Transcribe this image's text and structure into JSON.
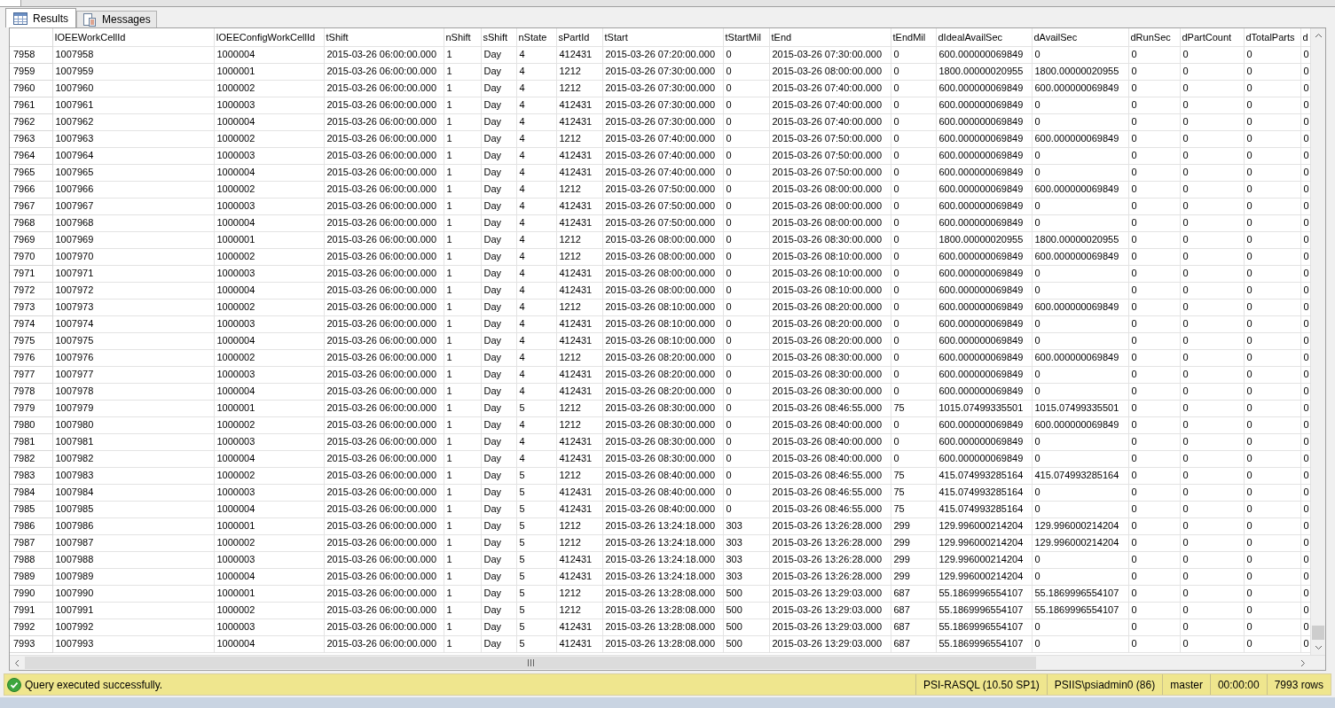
{
  "tabs": [
    {
      "label": "Results",
      "selected": true,
      "kind": "grid"
    },
    {
      "label": "Messages",
      "selected": false,
      "kind": "messages"
    }
  ],
  "grid": {
    "columns": [
      "IOEEWorkCellId",
      "IOEEConfigWorkCellId",
      "tShift",
      "nShift",
      "sShift",
      "nState",
      "sPartId",
      "tStart",
      "tStartMil",
      "tEnd",
      "tEndMil",
      "dIdealAvailSec",
      "dAvailSec",
      "dRunSec",
      "dPartCount",
      "dTotalParts",
      "d"
    ],
    "rows": [
      {
        "number": "7958",
        "cells": [
          "1007958",
          "1000004",
          "2015-03-26 06:00:00.000",
          "1",
          "Day",
          "4",
          "412431",
          "2015-03-26 07:20:00.000",
          "0",
          "2015-03-26 07:30:00.000",
          "0",
          "600.000000069849",
          "0",
          "0",
          "0",
          "0",
          "0"
        ]
      },
      {
        "number": "7959",
        "cells": [
          "1007959",
          "1000001",
          "2015-03-26 06:00:00.000",
          "1",
          "Day",
          "4",
          "1212",
          "2015-03-26 07:30:00.000",
          "0",
          "2015-03-26 08:00:00.000",
          "0",
          "1800.00000020955",
          "1800.00000020955",
          "0",
          "0",
          "0",
          "0"
        ]
      },
      {
        "number": "7960",
        "cells": [
          "1007960",
          "1000002",
          "2015-03-26 06:00:00.000",
          "1",
          "Day",
          "4",
          "1212",
          "2015-03-26 07:30:00.000",
          "0",
          "2015-03-26 07:40:00.000",
          "0",
          "600.000000069849",
          "600.000000069849",
          "0",
          "0",
          "0",
          "0"
        ]
      },
      {
        "number": "7961",
        "cells": [
          "1007961",
          "1000003",
          "2015-03-26 06:00:00.000",
          "1",
          "Day",
          "4",
          "412431",
          "2015-03-26 07:30:00.000",
          "0",
          "2015-03-26 07:40:00.000",
          "0",
          "600.000000069849",
          "0",
          "0",
          "0",
          "0",
          "0"
        ]
      },
      {
        "number": "7962",
        "cells": [
          "1007962",
          "1000004",
          "2015-03-26 06:00:00.000",
          "1",
          "Day",
          "4",
          "412431",
          "2015-03-26 07:30:00.000",
          "0",
          "2015-03-26 07:40:00.000",
          "0",
          "600.000000069849",
          "0",
          "0",
          "0",
          "0",
          "0"
        ]
      },
      {
        "number": "7963",
        "cells": [
          "1007963",
          "1000002",
          "2015-03-26 06:00:00.000",
          "1",
          "Day",
          "4",
          "1212",
          "2015-03-26 07:40:00.000",
          "0",
          "2015-03-26 07:50:00.000",
          "0",
          "600.000000069849",
          "600.000000069849",
          "0",
          "0",
          "0",
          "0"
        ]
      },
      {
        "number": "7964",
        "cells": [
          "1007964",
          "1000003",
          "2015-03-26 06:00:00.000",
          "1",
          "Day",
          "4",
          "412431",
          "2015-03-26 07:40:00.000",
          "0",
          "2015-03-26 07:50:00.000",
          "0",
          "600.000000069849",
          "0",
          "0",
          "0",
          "0",
          "0"
        ]
      },
      {
        "number": "7965",
        "cells": [
          "1007965",
          "1000004",
          "2015-03-26 06:00:00.000",
          "1",
          "Day",
          "4",
          "412431",
          "2015-03-26 07:40:00.000",
          "0",
          "2015-03-26 07:50:00.000",
          "0",
          "600.000000069849",
          "0",
          "0",
          "0",
          "0",
          "0"
        ]
      },
      {
        "number": "7966",
        "cells": [
          "1007966",
          "1000002",
          "2015-03-26 06:00:00.000",
          "1",
          "Day",
          "4",
          "1212",
          "2015-03-26 07:50:00.000",
          "0",
          "2015-03-26 08:00:00.000",
          "0",
          "600.000000069849",
          "600.000000069849",
          "0",
          "0",
          "0",
          "0"
        ]
      },
      {
        "number": "7967",
        "cells": [
          "1007967",
          "1000003",
          "2015-03-26 06:00:00.000",
          "1",
          "Day",
          "4",
          "412431",
          "2015-03-26 07:50:00.000",
          "0",
          "2015-03-26 08:00:00.000",
          "0",
          "600.000000069849",
          "0",
          "0",
          "0",
          "0",
          "0"
        ]
      },
      {
        "number": "7968",
        "cells": [
          "1007968",
          "1000004",
          "2015-03-26 06:00:00.000",
          "1",
          "Day",
          "4",
          "412431",
          "2015-03-26 07:50:00.000",
          "0",
          "2015-03-26 08:00:00.000",
          "0",
          "600.000000069849",
          "0",
          "0",
          "0",
          "0",
          "0"
        ]
      },
      {
        "number": "7969",
        "cells": [
          "1007969",
          "1000001",
          "2015-03-26 06:00:00.000",
          "1",
          "Day",
          "4",
          "1212",
          "2015-03-26 08:00:00.000",
          "0",
          "2015-03-26 08:30:00.000",
          "0",
          "1800.00000020955",
          "1800.00000020955",
          "0",
          "0",
          "0",
          "0"
        ]
      },
      {
        "number": "7970",
        "cells": [
          "1007970",
          "1000002",
          "2015-03-26 06:00:00.000",
          "1",
          "Day",
          "4",
          "1212",
          "2015-03-26 08:00:00.000",
          "0",
          "2015-03-26 08:10:00.000",
          "0",
          "600.000000069849",
          "600.000000069849",
          "0",
          "0",
          "0",
          "0"
        ]
      },
      {
        "number": "7971",
        "cells": [
          "1007971",
          "1000003",
          "2015-03-26 06:00:00.000",
          "1",
          "Day",
          "4",
          "412431",
          "2015-03-26 08:00:00.000",
          "0",
          "2015-03-26 08:10:00.000",
          "0",
          "600.000000069849",
          "0",
          "0",
          "0",
          "0",
          "0"
        ]
      },
      {
        "number": "7972",
        "cells": [
          "1007972",
          "1000004",
          "2015-03-26 06:00:00.000",
          "1",
          "Day",
          "4",
          "412431",
          "2015-03-26 08:00:00.000",
          "0",
          "2015-03-26 08:10:00.000",
          "0",
          "600.000000069849",
          "0",
          "0",
          "0",
          "0",
          "0"
        ]
      },
      {
        "number": "7973",
        "cells": [
          "1007973",
          "1000002",
          "2015-03-26 06:00:00.000",
          "1",
          "Day",
          "4",
          "1212",
          "2015-03-26 08:10:00.000",
          "0",
          "2015-03-26 08:20:00.000",
          "0",
          "600.000000069849",
          "600.000000069849",
          "0",
          "0",
          "0",
          "0"
        ]
      },
      {
        "number": "7974",
        "cells": [
          "1007974",
          "1000003",
          "2015-03-26 06:00:00.000",
          "1",
          "Day",
          "4",
          "412431",
          "2015-03-26 08:10:00.000",
          "0",
          "2015-03-26 08:20:00.000",
          "0",
          "600.000000069849",
          "0",
          "0",
          "0",
          "0",
          "0"
        ]
      },
      {
        "number": "7975",
        "cells": [
          "1007975",
          "1000004",
          "2015-03-26 06:00:00.000",
          "1",
          "Day",
          "4",
          "412431",
          "2015-03-26 08:10:00.000",
          "0",
          "2015-03-26 08:20:00.000",
          "0",
          "600.000000069849",
          "0",
          "0",
          "0",
          "0",
          "0"
        ]
      },
      {
        "number": "7976",
        "cells": [
          "1007976",
          "1000002",
          "2015-03-26 06:00:00.000",
          "1",
          "Day",
          "4",
          "1212",
          "2015-03-26 08:20:00.000",
          "0",
          "2015-03-26 08:30:00.000",
          "0",
          "600.000000069849",
          "600.000000069849",
          "0",
          "0",
          "0",
          "0"
        ]
      },
      {
        "number": "7977",
        "cells": [
          "1007977",
          "1000003",
          "2015-03-26 06:00:00.000",
          "1",
          "Day",
          "4",
          "412431",
          "2015-03-26 08:20:00.000",
          "0",
          "2015-03-26 08:30:00.000",
          "0",
          "600.000000069849",
          "0",
          "0",
          "0",
          "0",
          "0"
        ]
      },
      {
        "number": "7978",
        "cells": [
          "1007978",
          "1000004",
          "2015-03-26 06:00:00.000",
          "1",
          "Day",
          "4",
          "412431",
          "2015-03-26 08:20:00.000",
          "0",
          "2015-03-26 08:30:00.000",
          "0",
          "600.000000069849",
          "0",
          "0",
          "0",
          "0",
          "0"
        ]
      },
      {
        "number": "7979",
        "cells": [
          "1007979",
          "1000001",
          "2015-03-26 06:00:00.000",
          "1",
          "Day",
          "5",
          "1212",
          "2015-03-26 08:30:00.000",
          "0",
          "2015-03-26 08:46:55.000",
          "75",
          "1015.07499335501",
          "1015.07499335501",
          "0",
          "0",
          "0",
          "0"
        ]
      },
      {
        "number": "7980",
        "cells": [
          "1007980",
          "1000002",
          "2015-03-26 06:00:00.000",
          "1",
          "Day",
          "4",
          "1212",
          "2015-03-26 08:30:00.000",
          "0",
          "2015-03-26 08:40:00.000",
          "0",
          "600.000000069849",
          "600.000000069849",
          "0",
          "0",
          "0",
          "0"
        ]
      },
      {
        "number": "7981",
        "cells": [
          "1007981",
          "1000003",
          "2015-03-26 06:00:00.000",
          "1",
          "Day",
          "4",
          "412431",
          "2015-03-26 08:30:00.000",
          "0",
          "2015-03-26 08:40:00.000",
          "0",
          "600.000000069849",
          "0",
          "0",
          "0",
          "0",
          "0"
        ]
      },
      {
        "number": "7982",
        "cells": [
          "1007982",
          "1000004",
          "2015-03-26 06:00:00.000",
          "1",
          "Day",
          "4",
          "412431",
          "2015-03-26 08:30:00.000",
          "0",
          "2015-03-26 08:40:00.000",
          "0",
          "600.000000069849",
          "0",
          "0",
          "0",
          "0",
          "0"
        ]
      },
      {
        "number": "7983",
        "cells": [
          "1007983",
          "1000002",
          "2015-03-26 06:00:00.000",
          "1",
          "Day",
          "5",
          "1212",
          "2015-03-26 08:40:00.000",
          "0",
          "2015-03-26 08:46:55.000",
          "75",
          "415.074993285164",
          "415.074993285164",
          "0",
          "0",
          "0",
          "0"
        ]
      },
      {
        "number": "7984",
        "cells": [
          "1007984",
          "1000003",
          "2015-03-26 06:00:00.000",
          "1",
          "Day",
          "5",
          "412431",
          "2015-03-26 08:40:00.000",
          "0",
          "2015-03-26 08:46:55.000",
          "75",
          "415.074993285164",
          "0",
          "0",
          "0",
          "0",
          "0"
        ]
      },
      {
        "number": "7985",
        "cells": [
          "1007985",
          "1000004",
          "2015-03-26 06:00:00.000",
          "1",
          "Day",
          "5",
          "412431",
          "2015-03-26 08:40:00.000",
          "0",
          "2015-03-26 08:46:55.000",
          "75",
          "415.074993285164",
          "0",
          "0",
          "0",
          "0",
          "0"
        ]
      },
      {
        "number": "7986",
        "cells": [
          "1007986",
          "1000001",
          "2015-03-26 06:00:00.000",
          "1",
          "Day",
          "5",
          "1212",
          "2015-03-26 13:24:18.000",
          "303",
          "2015-03-26 13:26:28.000",
          "299",
          "129.996000214204",
          "129.996000214204",
          "0",
          "0",
          "0",
          "0"
        ]
      },
      {
        "number": "7987",
        "cells": [
          "1007987",
          "1000002",
          "2015-03-26 06:00:00.000",
          "1",
          "Day",
          "5",
          "1212",
          "2015-03-26 13:24:18.000",
          "303",
          "2015-03-26 13:26:28.000",
          "299",
          "129.996000214204",
          "129.996000214204",
          "0",
          "0",
          "0",
          "0"
        ]
      },
      {
        "number": "7988",
        "cells": [
          "1007988",
          "1000003",
          "2015-03-26 06:00:00.000",
          "1",
          "Day",
          "5",
          "412431",
          "2015-03-26 13:24:18.000",
          "303",
          "2015-03-26 13:26:28.000",
          "299",
          "129.996000214204",
          "0",
          "0",
          "0",
          "0",
          "0"
        ]
      },
      {
        "number": "7989",
        "cells": [
          "1007989",
          "1000004",
          "2015-03-26 06:00:00.000",
          "1",
          "Day",
          "5",
          "412431",
          "2015-03-26 13:24:18.000",
          "303",
          "2015-03-26 13:26:28.000",
          "299",
          "129.996000214204",
          "0",
          "0",
          "0",
          "0",
          "0"
        ]
      },
      {
        "number": "7990",
        "cells": [
          "1007990",
          "1000001",
          "2015-03-26 06:00:00.000",
          "1",
          "Day",
          "5",
          "1212",
          "2015-03-26 13:28:08.000",
          "500",
          "2015-03-26 13:29:03.000",
          "687",
          "55.1869996554107",
          "55.1869996554107",
          "0",
          "0",
          "0",
          "0"
        ]
      },
      {
        "number": "7991",
        "cells": [
          "1007991",
          "1000002",
          "2015-03-26 06:00:00.000",
          "1",
          "Day",
          "5",
          "1212",
          "2015-03-26 13:28:08.000",
          "500",
          "2015-03-26 13:29:03.000",
          "687",
          "55.1869996554107",
          "55.1869996554107",
          "0",
          "0",
          "0",
          "0"
        ]
      },
      {
        "number": "7992",
        "cells": [
          "1007992",
          "1000003",
          "2015-03-26 06:00:00.000",
          "1",
          "Day",
          "5",
          "412431",
          "2015-03-26 13:28:08.000",
          "500",
          "2015-03-26 13:29:03.000",
          "687",
          "55.1869996554107",
          "0",
          "0",
          "0",
          "0",
          "0"
        ]
      },
      {
        "number": "7993",
        "cells": [
          "1007993",
          "1000004",
          "2015-03-26 06:00:00.000",
          "1",
          "Day",
          "5",
          "412431",
          "2015-03-26 13:28:08.000",
          "500",
          "2015-03-26 13:29:03.000",
          "687",
          "55.1869996554107",
          "0",
          "0",
          "0",
          "0",
          "0"
        ]
      }
    ]
  },
  "status_bar": {
    "message": "Query executed successfully.",
    "fields": [
      "PSI-RASQL (10.50 SP1)",
      "PSIIS\\psiadmin0 (86)",
      "master",
      "00:00:00",
      "7993 rows"
    ]
  }
}
